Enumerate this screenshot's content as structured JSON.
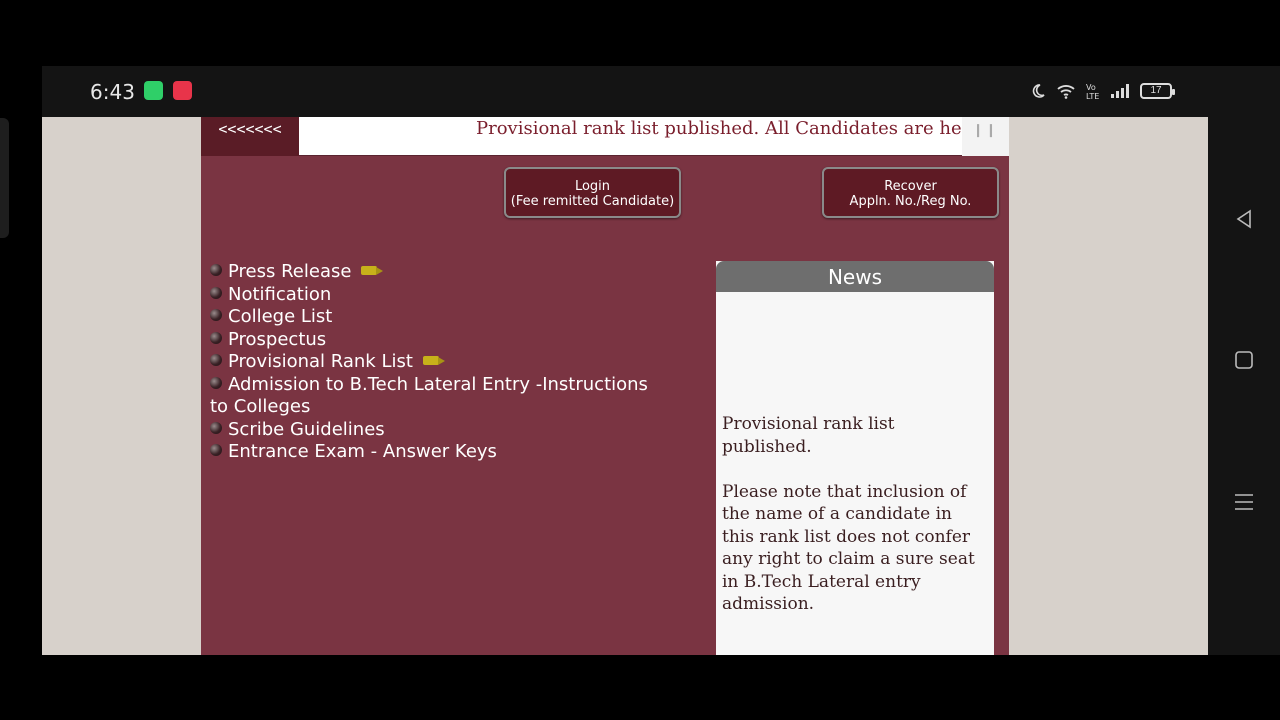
{
  "status_bar": {
    "time": "6:43",
    "battery": "17",
    "icons": [
      "moon-icon",
      "wifi-icon",
      "volte-icon",
      "signal-icon",
      "battery-icon"
    ]
  },
  "site": {
    "marquee": {
      "back_label": "<<<<<<<",
      "text": "Provisional rank list published.   All Candidates are hereby informed",
      "pause_label": "❙❙"
    },
    "buttons": {
      "login_line1": "Login",
      "login_line2": "(Fee remitted Candidate)",
      "recover_line1": "Recover",
      "recover_line2": "Appln. No./Reg No."
    },
    "links": [
      {
        "label": "Press Release",
        "new": true
      },
      {
        "label": "Notification",
        "new": false
      },
      {
        "label": "College List",
        "new": false
      },
      {
        "label": "Prospectus",
        "new": false
      },
      {
        "label": "Provisional Rank List",
        "new": true
      },
      {
        "label": "Admission to B.Tech Lateral Entry -Instructions to Colleges",
        "new": false
      },
      {
        "label": "Scribe Guidelines",
        "new": false
      },
      {
        "label": "Entrance Exam - Answer Keys",
        "new": false
      }
    ],
    "news": {
      "title": "News",
      "para1": "Provisional rank list published.",
      "para2": "Please note that inclusion of the name of a candidate in this rank list does not confer any right to claim a sure seat in B.Tech Lateral entry admission."
    }
  },
  "colors": {
    "brand": "#7a3442",
    "button": "#5e1a24",
    "news_header": "#6e6e6e"
  }
}
